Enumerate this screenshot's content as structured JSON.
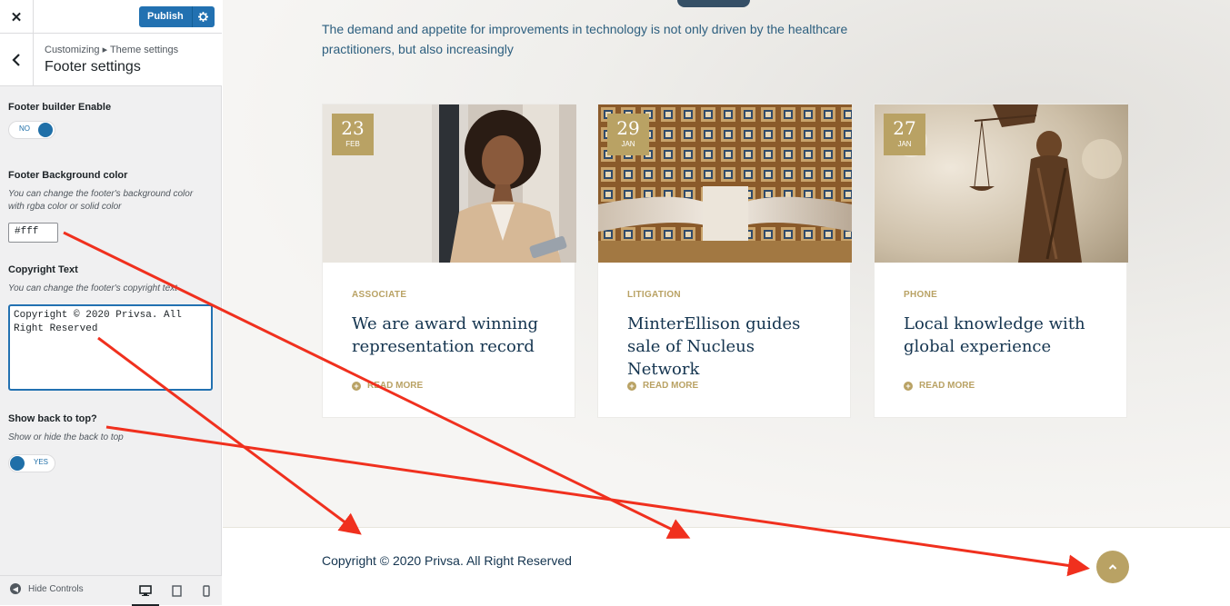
{
  "customizer": {
    "close_label": "✕",
    "publish_label": "Publish",
    "breadcrumb": "Customizing ▸ Theme settings",
    "section_title": "Footer settings",
    "footer_builder": {
      "label": "Footer builder Enable",
      "state": "NO"
    },
    "bg_color": {
      "label": "Footer Background color",
      "description": "You can change the footer's background color with rgba color or solid color",
      "value": "#fff"
    },
    "copyright": {
      "label": "Copyright Text",
      "description": "You can change the footer's copyright text",
      "value": "Copyright © 2020 Privsa. All Right Reserved"
    },
    "back_to_top": {
      "label": "Show back to top?",
      "description": "Show or hide the back to top",
      "state": "YES"
    },
    "hide_controls_label": "Hide Controls"
  },
  "preview": {
    "subtitle": "The demand and appetite for improvements in technology is not only driven by the healthcare practitioners, but also increasingly",
    "cards": [
      {
        "day": "23",
        "month": "FEB",
        "category": "ASSOCIATE",
        "title": "We are award winning representation record",
        "read_more": "READ MORE"
      },
      {
        "day": "29",
        "month": "JAN",
        "category": "LITIGATION",
        "title": "MinterEllison guides sale of Nucleus Network",
        "read_more": "READ MORE"
      },
      {
        "day": "27",
        "month": "JAN",
        "category": "PHONE",
        "title": "Local knowledge with global experience",
        "read_more": "READ MORE"
      }
    ],
    "footer_copyright": "Copyright © 2020 Privsa. All Right Reserved"
  },
  "colors": {
    "accent_gold": "#b9a264",
    "navy": "#14344f",
    "wp_blue": "#2271b1",
    "annotation_red": "#f0301e"
  },
  "icons": [
    "close-icon",
    "gear-icon",
    "chevron-left-icon",
    "hide-controls-icon",
    "desktop-icon",
    "tablet-icon",
    "mobile-icon",
    "plus-circle-icon",
    "chevron-up-icon"
  ]
}
